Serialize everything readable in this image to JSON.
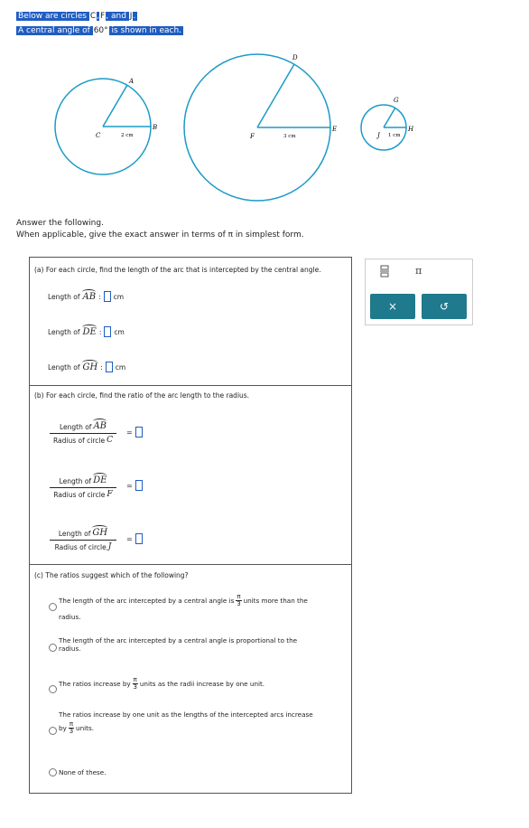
{
  "intro": {
    "line1_prefix": "Below are circles",
    "c1": "C",
    "comma": ",",
    "c2": "F",
    "and": "and",
    "c3": "J",
    "dot": ".",
    "line2_prefix": "A central angle of",
    "angle": "60°",
    "line2_suffix": "is shown in each."
  },
  "figure": {
    "circle1": {
      "center": "C",
      "p1": "A",
      "p2": "B",
      "radius_label": "2 cm"
    },
    "circle2": {
      "center": "F",
      "p1": "D",
      "p2": "E",
      "radius_label": "3 cm"
    },
    "circle3": {
      "center": "J",
      "p1": "G",
      "p2": "H",
      "radius_label": "1 cm"
    },
    "color": "#1a9bc8"
  },
  "instructions": {
    "line1": "Answer the following.",
    "line2": "When applicable, give the exact answer in terms of π in simplest form."
  },
  "partA": {
    "prompt": "(a) For each circle, find the length of the arc that is intercepted by the central angle.",
    "rows": [
      {
        "label": "Length of",
        "arc": "AB",
        "colon": ":",
        "unit": "cm"
      },
      {
        "label": "Length of",
        "arc": "DE",
        "colon": ":",
        "unit": "cm"
      },
      {
        "label": "Length of",
        "arc": "GH",
        "colon": ":",
        "unit": "cm"
      }
    ]
  },
  "partB": {
    "prompt": "(b) For each circle, find the ratio of the arc length to the radius.",
    "rows": [
      {
        "num_label": "Length of",
        "arc": "AB",
        "den_label": "Radius of circle",
        "circle": "C",
        "eq": "="
      },
      {
        "num_label": "Length of",
        "arc": "DE",
        "den_label": "Radius of circle",
        "circle": "F",
        "eq": "="
      },
      {
        "num_label": "Length of",
        "arc": "GH",
        "den_label": "Radius of circle",
        "circle": "J",
        "eq": "="
      }
    ]
  },
  "partC": {
    "prompt": "(c) The ratios suggest which of the following?",
    "opt1_a": "The length of the arc intercepted by a central angle is",
    "opt1_b": "units more than the",
    "opt1_c": "radius.",
    "opt2_a": "The length of the arc intercepted by a central angle is proportional to the",
    "opt2_b": "radius.",
    "opt3_a": "The ratios increase by",
    "opt3_b": "units as the radii increase by one unit.",
    "opt4_a": "The ratios increase by one unit as the lengths of the intercepted arcs increase",
    "opt4_b": "by",
    "opt4_c": "units.",
    "opt5": "None of these.",
    "pi": "π",
    "three": "3"
  },
  "tools": {
    "fraction_icon": "fraction-icon",
    "pi": "π",
    "clear": "×",
    "undo": "↺",
    "accent": "#1e7a8c"
  }
}
